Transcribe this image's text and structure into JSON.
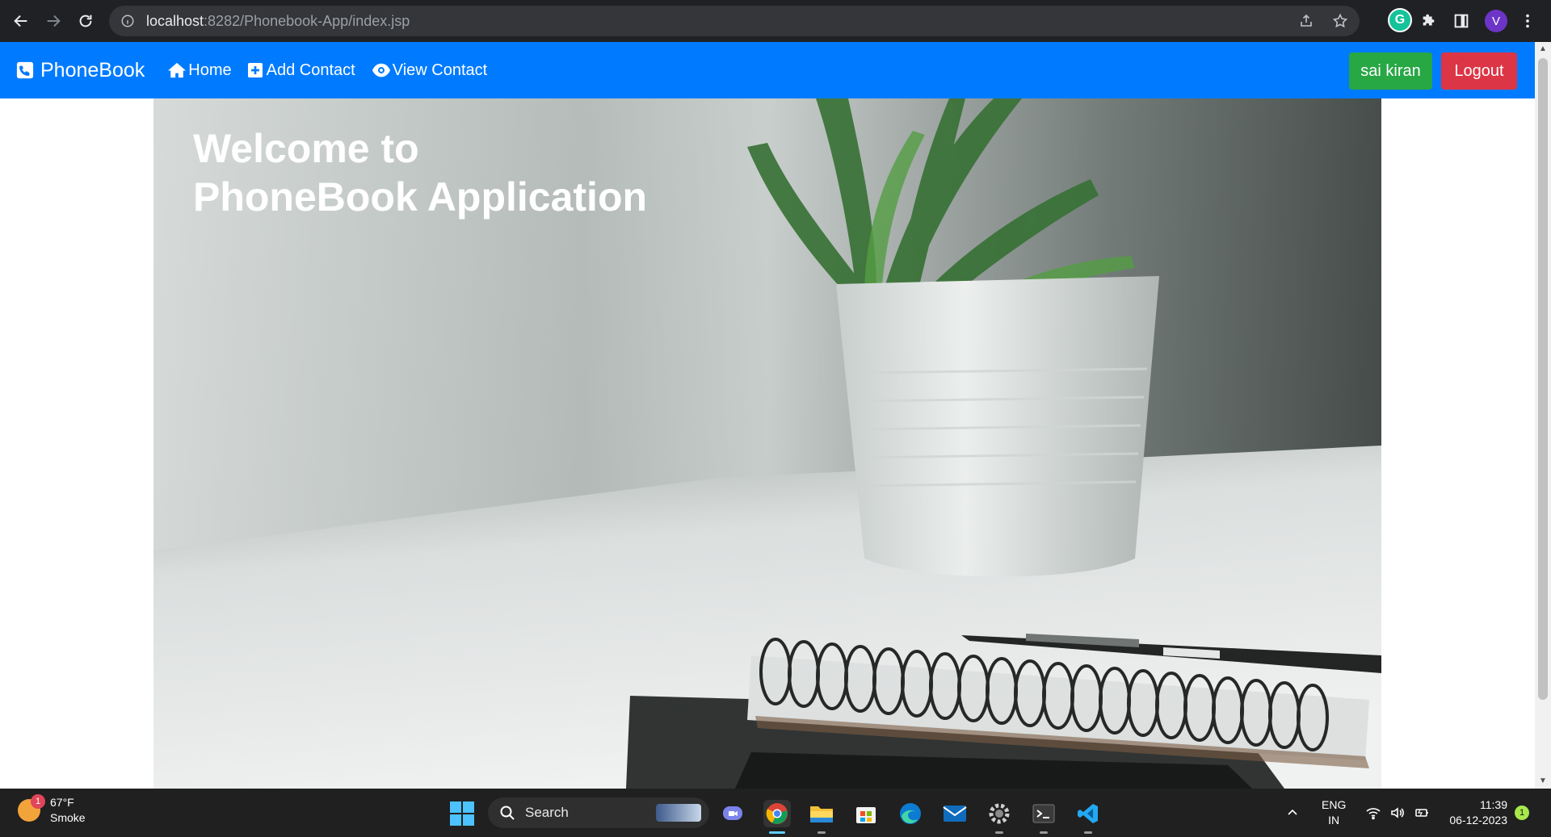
{
  "browser": {
    "url_host": "localhost",
    "url_rest": ":8282/Phonebook-App/index.jsp",
    "profile_initial": "V"
  },
  "navbar": {
    "brand": "PhoneBook",
    "links": [
      {
        "label": "Home",
        "icon": "home-icon"
      },
      {
        "label": "Add Contact",
        "icon": "plus-square-icon"
      },
      {
        "label": "View Contact",
        "icon": "eye-icon"
      }
    ],
    "user_button": "sai kiran",
    "logout_button": "Logout",
    "colors": {
      "navbar": "#007bff",
      "user": "#28a745",
      "logout": "#dc3545"
    }
  },
  "hero": {
    "title_line1": "Welcome to",
    "title_line2": "PhoneBook Application"
  },
  "taskbar": {
    "weather_temp": "67°F",
    "weather_desc": "Smoke",
    "weather_badge": "1",
    "search_label": "Search",
    "lang_line1": "ENG",
    "lang_line2": "IN",
    "time": "11:39",
    "date": "06-12-2023",
    "notification_count": "1"
  }
}
